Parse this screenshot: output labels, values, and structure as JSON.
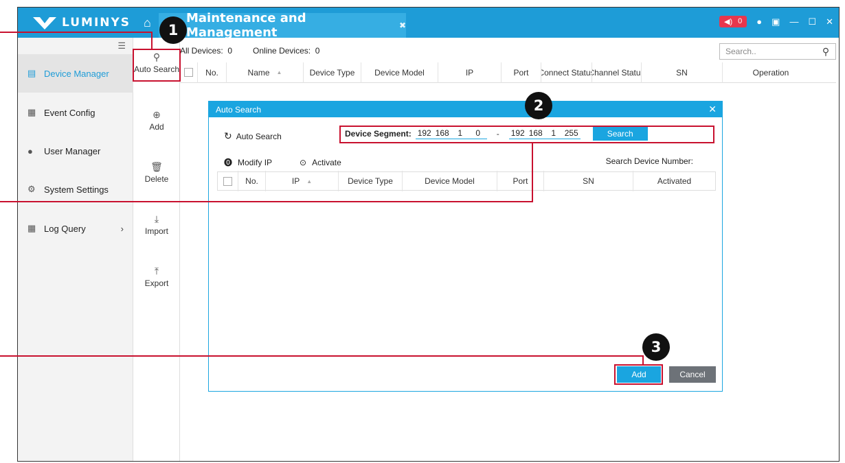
{
  "app": {
    "brand": "LUMINYS",
    "page_tab": "Maintenance and Management",
    "alarm_count": "0",
    "colors": {
      "accent": "#1e9cd7",
      "annotation": "#c8102e",
      "alarm": "#e8364d"
    }
  },
  "sidebar": {
    "items": [
      {
        "label": "Device Manager",
        "icon": "device-monitor-icon"
      },
      {
        "label": "Event Config",
        "icon": "event-doc-icon"
      },
      {
        "label": "User Manager",
        "icon": "user-icon"
      },
      {
        "label": "System Settings",
        "icon": "gear-icon"
      },
      {
        "label": "Log Query",
        "icon": "log-doc-icon"
      }
    ]
  },
  "toolbar": {
    "auto_search": "Auto Search",
    "add": "Add",
    "delete": "Delete",
    "import": "Import",
    "export": "Export"
  },
  "main": {
    "all_devices_label": "All Devices:",
    "all_devices_count": "0",
    "online_devices_label": "Online Devices:",
    "online_devices_count": "0",
    "search_placeholder": "Search..",
    "columns": [
      "No.",
      "Name",
      "Device Type",
      "Device Model",
      "IP",
      "Port",
      "Connect Status",
      "Channel Status",
      "SN",
      "Operation"
    ]
  },
  "dialog": {
    "title": "Auto Search",
    "refresh_label": "Auto Search",
    "segment_label": "Device Segment:",
    "start_ip": [
      "192",
      "168",
      "1",
      "0"
    ],
    "end_ip": [
      "192",
      "168",
      "1",
      "255"
    ],
    "dash": "-",
    "search_button": "Search",
    "modify_ip": "Modify IP",
    "activate": "Activate",
    "search_count_label": "Search Device Number:",
    "columns": [
      "No.",
      "IP",
      "Device Type",
      "Device Model",
      "Port",
      "SN",
      "Activated"
    ],
    "add_button": "Add",
    "cancel_button": "Cancel"
  },
  "annotations": {
    "step1": "1",
    "step2": "2",
    "step3": "3"
  }
}
